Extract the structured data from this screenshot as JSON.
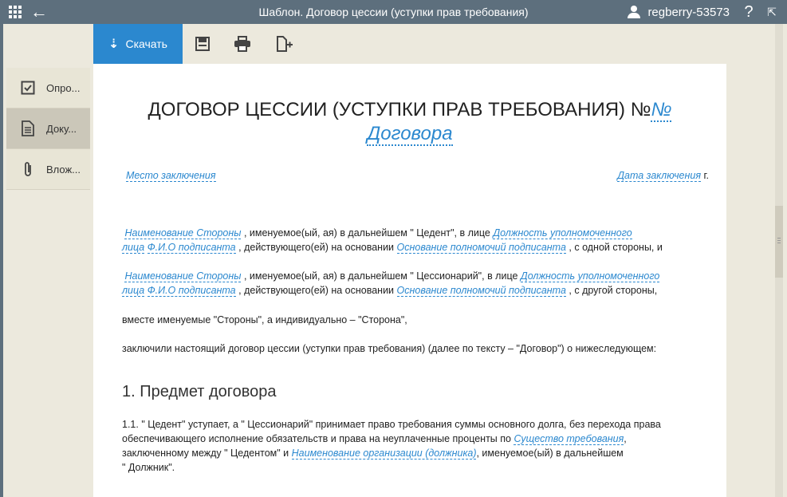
{
  "topbar": {
    "title": "Шаблон. Договор цессии (уступки прав требования)",
    "username": "regberry-53573",
    "help": "?"
  },
  "sidebar": {
    "items": [
      {
        "label": "Опро...",
        "icon": "checkbox-icon",
        "active": false
      },
      {
        "label": "Доку...",
        "icon": "document-icon",
        "active": true
      },
      {
        "label": "Влож...",
        "icon": "paperclip-icon",
        "active": false
      }
    ]
  },
  "toolbar": {
    "download_label": "Скачать",
    "tools": [
      "save-icon",
      "print-icon",
      "add-file-icon"
    ]
  },
  "document": {
    "title_line1": "ДОГОВОР ЦЕССИИ (УСТУПКИ ПРАВ ТРЕБОВАНИЯ) №",
    "title_field_no": "№",
    "title_field_contract": "Договора",
    "place_field": "Место заключения",
    "date_field": "Дата заключения",
    "date_suffix": "г.",
    "p1": {
      "party_field": "Наименование Стороны",
      "t1": ", именуемое(ый, ая) в дальнейшем \" Цедент\", в лице",
      "position_field_1": "Должность уполномоченного",
      "position_field_2": "лица",
      "fio_field": "Ф.И.О подписанта",
      "t2": ", действующего(ей) на основании",
      "basis_field": "Основание полномочий подписанта",
      "t3": ", с одной стороны, и"
    },
    "p2": {
      "party_field": "Наименование Стороны",
      "t1": ", именуемое(ый, ая) в дальнейшем \" Цессионарий\", в лице",
      "position_field_1": "Должность уполномоченного",
      "position_field_2": "лица",
      "fio_field": "Ф.И.О подписанта",
      "t2": ", действующего(ей) на основании",
      "basis_field": "Основание полномочий подписанта",
      "t3": ", с другой стороны,"
    },
    "p3": "вместе именуемые \"Стороны\", а индивидуально – \"Сторона\",",
    "p4": "заключили настоящий договор цессии (уступки прав требования) (далее по тексту – \"Договор\") о нижеследующем:",
    "section1_heading": "1. Предмет договора",
    "s11": {
      "l1": "1.1.  \" Цедент\" уступает, а \" Цессионарий\" принимает право требования суммы основного долга, без перехода права",
      "l2a": "обеспечивающего исполнение обязательств и права на неуплаченные проценты по",
      "claim_field": "Существо требования",
      "l2b": ",",
      "l3a": "заключенному между \" Цедентом\" и",
      "debtor_field": "Наименование организации (должника)",
      "l3b": ", именуемое(ый) в дальнейшем",
      "l4": "\" Должник\"."
    }
  }
}
